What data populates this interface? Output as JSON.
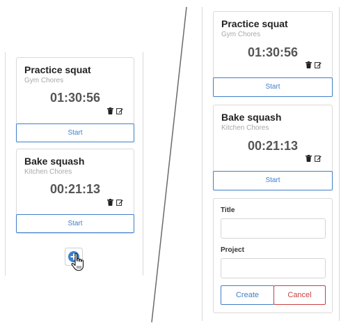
{
  "left_panel": {
    "timers": [
      {
        "title": "Practice squat",
        "project": "Gym Chores",
        "elapsed": "01:30:56",
        "start_label": "Start"
      },
      {
        "title": "Bake squash",
        "project": "Kitchen Chores",
        "elapsed": "00:21:13",
        "start_label": "Start"
      }
    ],
    "add_button_icon": "plus-icon",
    "cursor_icon": "hand-pointer-icon"
  },
  "right_panel": {
    "timers": [
      {
        "title": "Practice squat",
        "project": "Gym Chores",
        "elapsed": "01:30:56",
        "start_label": "Start"
      },
      {
        "title": "Bake squash",
        "project": "Kitchen Chores",
        "elapsed": "00:21:13",
        "start_label": "Start"
      }
    ],
    "form": {
      "title_label": "Title",
      "title_value": "",
      "project_label": "Project",
      "project_value": "",
      "create_label": "Create",
      "cancel_label": "Cancel"
    }
  },
  "colors": {
    "accent_blue": "#3f7fc9",
    "danger_red": "#c93f3f",
    "border": "#d9d9d9",
    "muted_text": "#a8a8a8"
  }
}
